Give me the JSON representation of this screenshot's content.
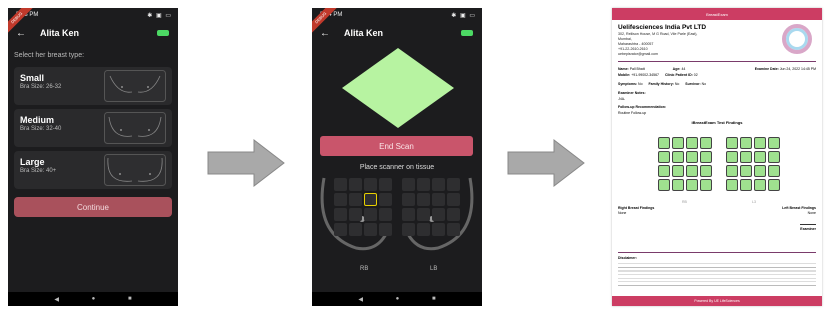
{
  "phone1": {
    "status_time": "5:53 PM",
    "status_right": "✱ ▣ ▭",
    "title": "Alita Ken",
    "prompt": "Select her breast type:",
    "sizes": [
      {
        "name": "Small",
        "size": "Bra Size: 26-32"
      },
      {
        "name": "Medium",
        "size": "Bra Size: 32-40"
      },
      {
        "name": "Large",
        "size": "Bra Size: 40+"
      }
    ],
    "continue_label": "Continue"
  },
  "phone2": {
    "status_time": "5:54 PM",
    "status_right": "✱ ▣ ▭",
    "title": "Alita Ken",
    "end_scan_label": "End Scan",
    "place_label": "Place scanner on tissue",
    "left_label": "RB",
    "right_label": "LB"
  },
  "report": {
    "brand": "BreastExam",
    "company": "Uelifesciences India Pvt LTD",
    "address": [
      "302, Reliison House, M G Road, Vile Parle (East),",
      "Mumbai,",
      "Maharashtra - 400057",
      "+91-22-2610-2610",
      "uebepisrator@gmail.com"
    ],
    "name_label": "Name:",
    "name_value": "Pall Bhatt",
    "age_label": "Age:",
    "age_value": "44",
    "mobile_label": "Mobile:",
    "mobile_value": "+91-99002-34567",
    "clinic_label": "Clinic Patient ID:",
    "clinic_value": "02",
    "exam_date_label": "Examine Date:",
    "exam_date_value": "Jun 24, 2022 14:45 PM",
    "symptoms_label": "Symptoms:",
    "symptoms_value": "No",
    "family_label": "Family History:",
    "family_value": "No",
    "survivor_label": "Survivor:",
    "survivor_value": "No",
    "notes_label": "Examiner Notes:",
    "notes_value": "-NA-",
    "followup_label": "Follow-up Recommendation:",
    "followup_value": "Routine Follow-up",
    "findings_title": "iBreastExam Test Findings",
    "rb": "RB",
    "lb": "L3",
    "right_findings": "Right Breast Findings",
    "right_none": "None",
    "left_findings": "Left Breast Findings",
    "left_none": "None",
    "examiner": "Examiner",
    "disclaimer_title": "Disclaimer:",
    "footer": "Powered By UE LifeSciences"
  }
}
